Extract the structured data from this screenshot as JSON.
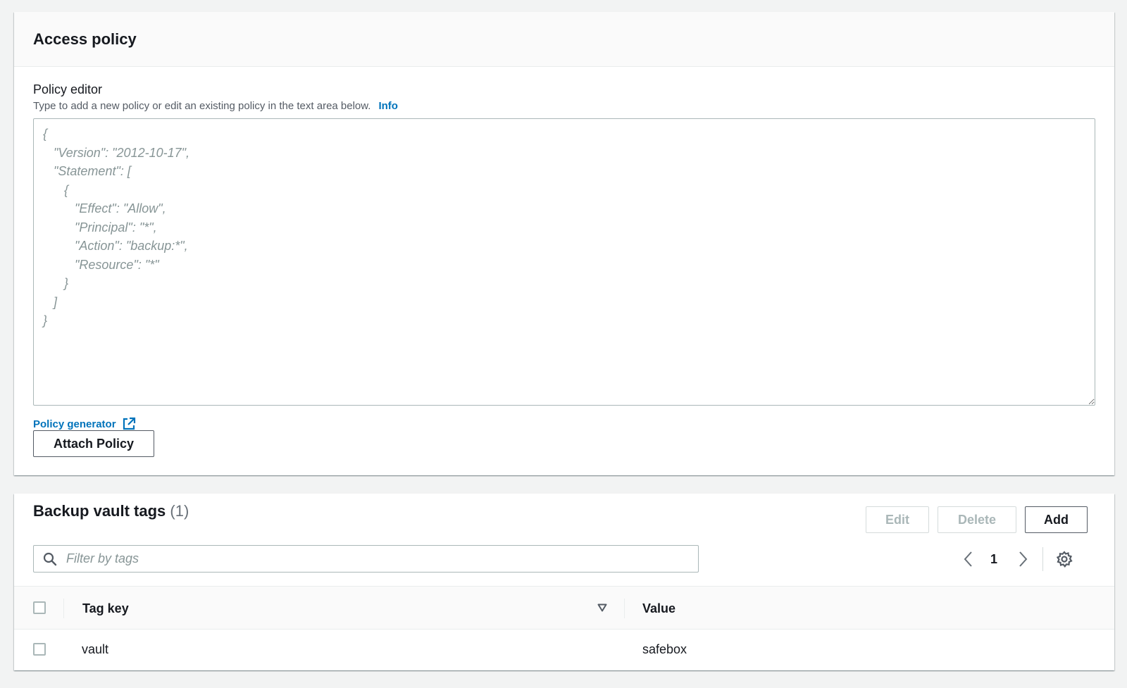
{
  "access_policy": {
    "title": "Access policy",
    "editor_label": "Policy editor",
    "editor_description": "Type to add a new policy or edit an existing policy in the text area below.",
    "info_link": "Info",
    "editor_placeholder": "{\n   \"Version\": \"2012-10-17\",\n   \"Statement\": [\n      {\n         \"Effect\": \"Allow\",\n         \"Principal\": \"*\",\n         \"Action\": \"backup:*\",\n         \"Resource\": \"*\"\n      }\n   ]\n}",
    "policy_generator_link": "Policy generator",
    "attach_button": "Attach Policy"
  },
  "tags": {
    "title": "Backup vault tags",
    "count": "(1)",
    "edit_button": "Edit",
    "delete_button": "Delete",
    "add_button": "Add",
    "filter_placeholder": "Filter by tags",
    "page_number": "1",
    "columns": {
      "tag_key": "Tag key",
      "value": "Value"
    },
    "rows": [
      {
        "key": "vault",
        "value": "safebox"
      }
    ]
  },
  "icons": [
    "external-link-icon",
    "search-icon",
    "chevron-left-icon",
    "chevron-right-icon",
    "gear-icon",
    "sort-down-icon"
  ],
  "colors": {
    "link": "#0073bb",
    "text": "#16191f",
    "muted": "#687078",
    "border": "#aab7b8",
    "background": "#f2f3f3"
  }
}
